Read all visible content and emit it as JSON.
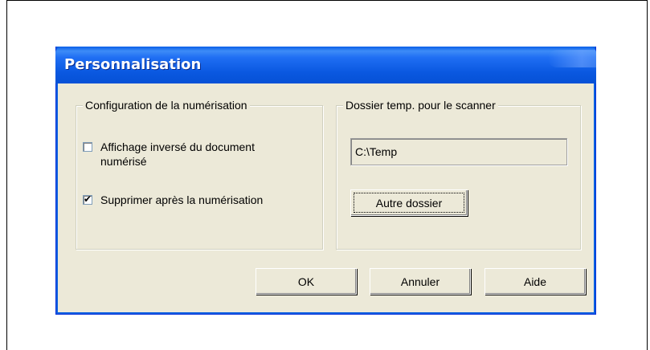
{
  "dialog": {
    "title": "Personnalisation"
  },
  "scan_config": {
    "legend": "Configuration de la numérisation",
    "options": [
      {
        "label_line1": "Affichage inversé du document",
        "label_line2": "numérisé",
        "checked": false
      },
      {
        "label_line1": "Supprimer après la numérisation",
        "checked": true
      }
    ]
  },
  "temp_folder": {
    "legend": "Dossier temp. pour le scanner",
    "path": "C:\\Temp",
    "browse_label": "Autre dossier"
  },
  "buttons": {
    "ok": "OK",
    "cancel": "Annuler",
    "help": "Aide"
  }
}
